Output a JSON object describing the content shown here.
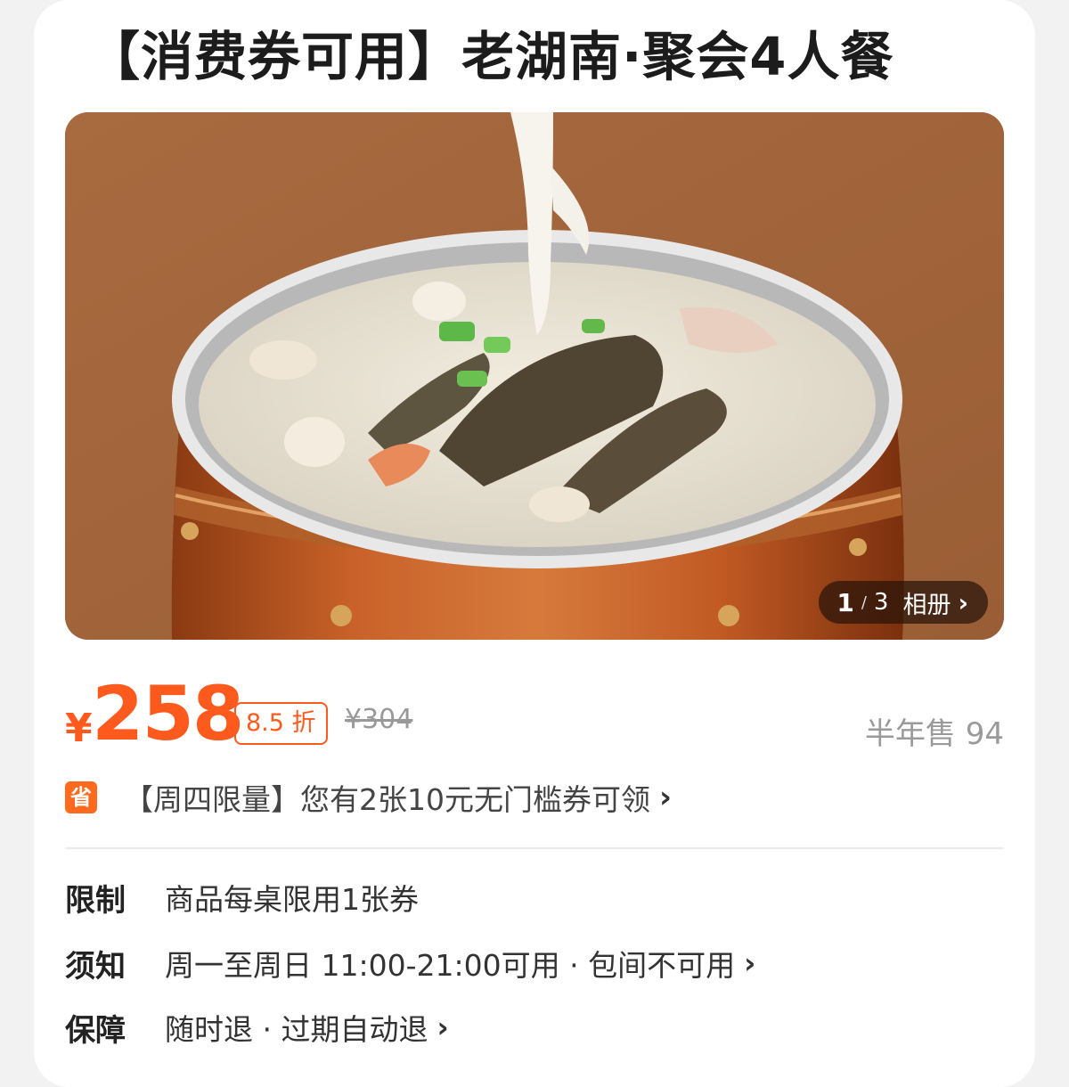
{
  "title": "【消费券可用】老湖南·聚会4人餐",
  "gallery": {
    "current": "1",
    "separator": "/",
    "total": "3",
    "label": "相册",
    "chevron": "›"
  },
  "price": {
    "currency": "¥",
    "value": "258",
    "discount": "8.5 折",
    "original": "¥304",
    "sold": "半年售 94"
  },
  "coupon": {
    "badge": "省",
    "text": "【周四限量】您有2张10元无门槛券可领",
    "chevron": "›"
  },
  "info": [
    {
      "label": "限制",
      "value": "商品每桌限用1张券",
      "chevron": ""
    },
    {
      "label": "须知",
      "value": "周一至周日 11:00-21:00可用 · 包间不可用",
      "chevron": "›"
    },
    {
      "label": "保障",
      "value": "随时退 · 过期自动退",
      "chevron": "›"
    }
  ],
  "colors": {
    "accent": "#ff5a1e",
    "muted": "#9a9a9a"
  }
}
